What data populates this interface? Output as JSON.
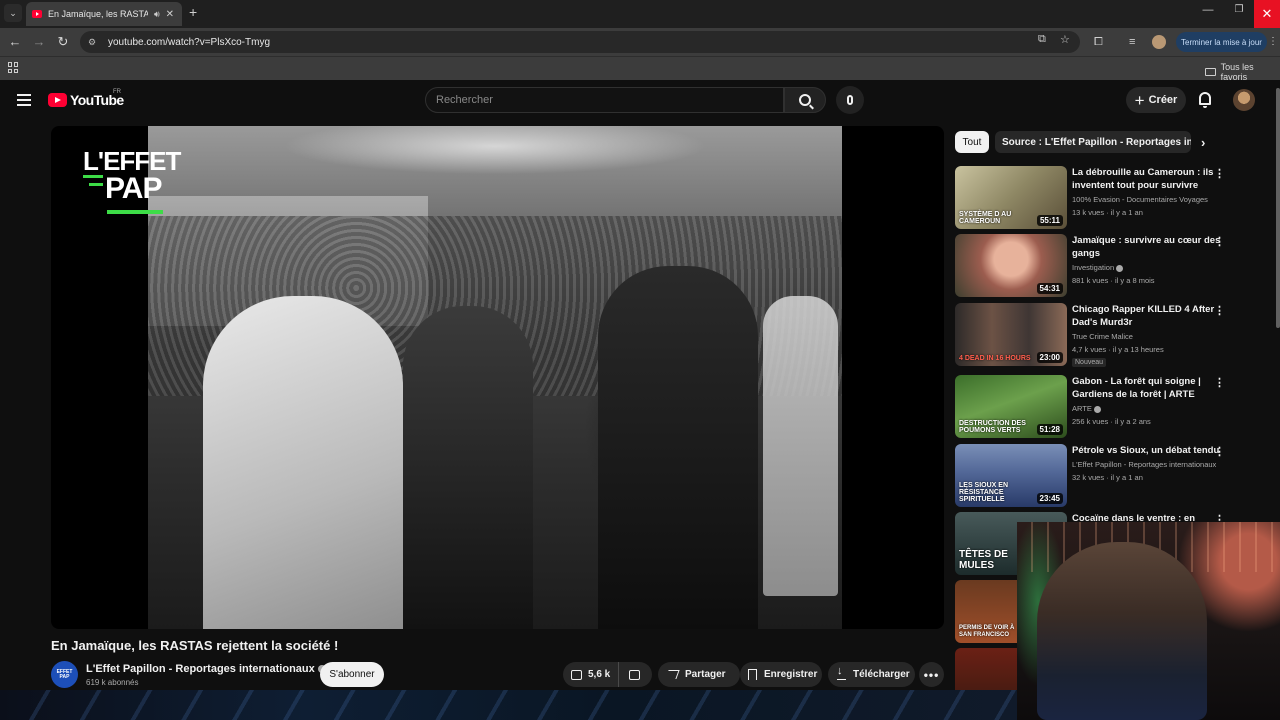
{
  "browser": {
    "tab_title": "En Jamaïque, les RASTAS re",
    "url": "youtube.com/watch?v=PlsXco-Tmyg",
    "update_label": "Terminer la mise à jour",
    "bookmarks_all": "Tous les favoris"
  },
  "youtube": {
    "logo_text": "YouTube",
    "region": "FR",
    "search_placeholder": "Rechercher",
    "create_label": "Créer"
  },
  "video": {
    "overlay_logo_line1": "L'EFFET",
    "overlay_logo_line2": "PAP",
    "title": "En Jamaïque, les RASTAS rejettent la société !",
    "channel": "L'Effet Papillon - Reportages internationaux",
    "channel_avatar_text": "EFFET PAP",
    "subscribers": "619 k abonnés",
    "subscribe_label": "S'abonner",
    "likes": "5,6 k",
    "share_label": "Partager",
    "save_label": "Enregistrer",
    "download_label": "Télécharger",
    "more_label": "•••"
  },
  "sidebar": {
    "chips": [
      "Tout",
      "Source : L'Effet Papillon - Reportages internationaux"
    ],
    "recommendations": [
      {
        "title": "La débrouille au Cameroun : ils inventent tout pour survivre",
        "channel": "100% Evasion - Documentaires Voyages",
        "meta": "13 k vues · il y a 1 an",
        "duration": "55:11",
        "thumb_caption": "SYSTÈME D AU CAMEROUN"
      },
      {
        "title": "Jamaïque : survivre au cœur des gangs",
        "channel": "Investigation",
        "meta": "881 k vues · il y a 8 mois",
        "duration": "54:31",
        "thumb_caption": ""
      },
      {
        "title": "Chicago Rapper KILLED 4 After Dad's Murd3r",
        "channel": "True Crime Malice",
        "meta": "4,7 k vues · il y a 13 heures",
        "duration": "23:00",
        "badge": "Nouveau",
        "thumb_caption": "4 DEAD IN 16 HOURS"
      },
      {
        "title": "Gabon - La forêt qui soigne | Gardiens de la forêt | ARTE",
        "channel": "ARTE",
        "meta": "256 k vues · il y a 2 ans",
        "duration": "51:28",
        "thumb_caption": "DESTRUCTION DES POUMONS VERTS"
      },
      {
        "title": "Pétrole vs Sioux, un débat tendu",
        "channel": "L'Effet Papillon - Reportages internationaux",
        "meta": "32 k vues · il y a 1 an",
        "duration": "23:45",
        "thumb_caption": "LES SIOUX EN RÉSISTANCE SPIRITUELLE"
      },
      {
        "title": "Cocaïne dans le ventre : en",
        "thumb_caption": "TÊTES DE MULES"
      },
      {
        "thumb_caption": "PERMIS DE VOIR À SAN FRANCISCO"
      }
    ]
  }
}
